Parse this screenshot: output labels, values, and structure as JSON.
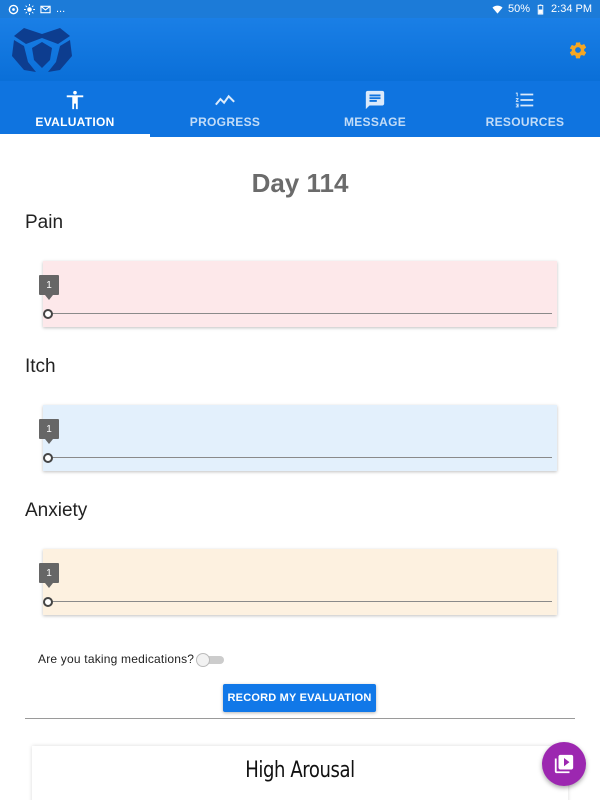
{
  "status_bar": {
    "left_dots": "...",
    "battery": "50%",
    "time": "2:34 PM"
  },
  "tabs": [
    {
      "label": "EVALUATION",
      "icon": "accessibility-icon",
      "active": true
    },
    {
      "label": "PROGRESS",
      "icon": "trending-icon",
      "active": false
    },
    {
      "label": "MESSAGE",
      "icon": "message-icon",
      "active": false
    },
    {
      "label": "RESOURCES",
      "icon": "list-numbered-icon",
      "active": false
    }
  ],
  "main": {
    "day_title": "Day 114",
    "sliders": [
      {
        "label": "Pain",
        "value": "1",
        "color": "#fde8ea"
      },
      {
        "label": "Itch",
        "value": "1",
        "color": "#e3f0fc"
      },
      {
        "label": "Anxiety",
        "value": "1",
        "color": "#fdf1e0"
      }
    ],
    "medication_question": "Are you taking medications?",
    "medication_toggle_on": false,
    "record_button": "RECORD MY EVALUATION",
    "preview_title": "High Arousal"
  },
  "colors": {
    "primary": "#0f74e0",
    "accent_settings": "#f5a623",
    "fab": "#9c27b0"
  }
}
